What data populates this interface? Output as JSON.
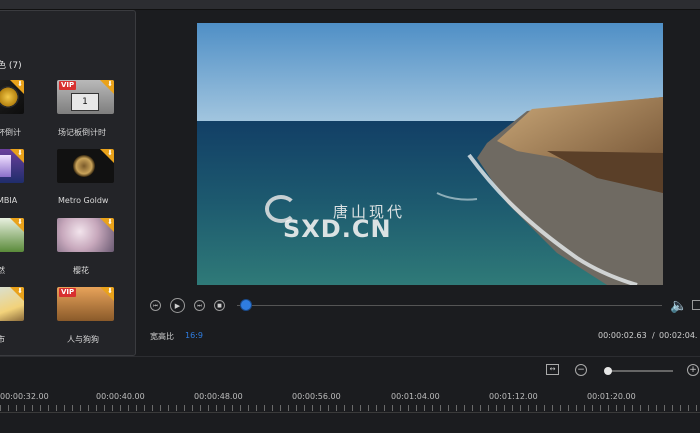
{
  "library": {
    "category_title": "色 (7)",
    "items": [
      {
        "caption": "杯倒计",
        "vip": false
      },
      {
        "caption": "场记板倒计时",
        "vip": true,
        "vip_label": "VIP",
        "number": "1"
      },
      {
        "caption": "MBIA",
        "vip": false
      },
      {
        "caption": "Metro Goldw",
        "vip": false
      },
      {
        "caption": "然",
        "vip": false
      },
      {
        "caption": "樱花",
        "vip": false
      },
      {
        "caption": "市",
        "vip": false
      },
      {
        "caption": "人与狗狗",
        "vip": true,
        "vip_label": "VIP"
      }
    ]
  },
  "watermark": {
    "cn": "唐山现代",
    "en": "SXD.CN"
  },
  "player": {
    "aspect_label": "宽高比",
    "aspect_value": "16:9",
    "current_time": "00:00:02.63",
    "separator": "/",
    "total_time": "00:02:04.",
    "progress": 0.02
  },
  "timeline": {
    "ticks": [
      "00:00:32.00",
      "00:00:40.00",
      "00:00:48.00",
      "00:00:56.00",
      "00:01:04.00",
      "00:01:12.00",
      "00:01:20.00"
    ],
    "zoom_level": 0.05
  },
  "colors": {
    "accent": "#2f7de0",
    "badge": "#e9a21b",
    "vip": "#d8302f"
  }
}
